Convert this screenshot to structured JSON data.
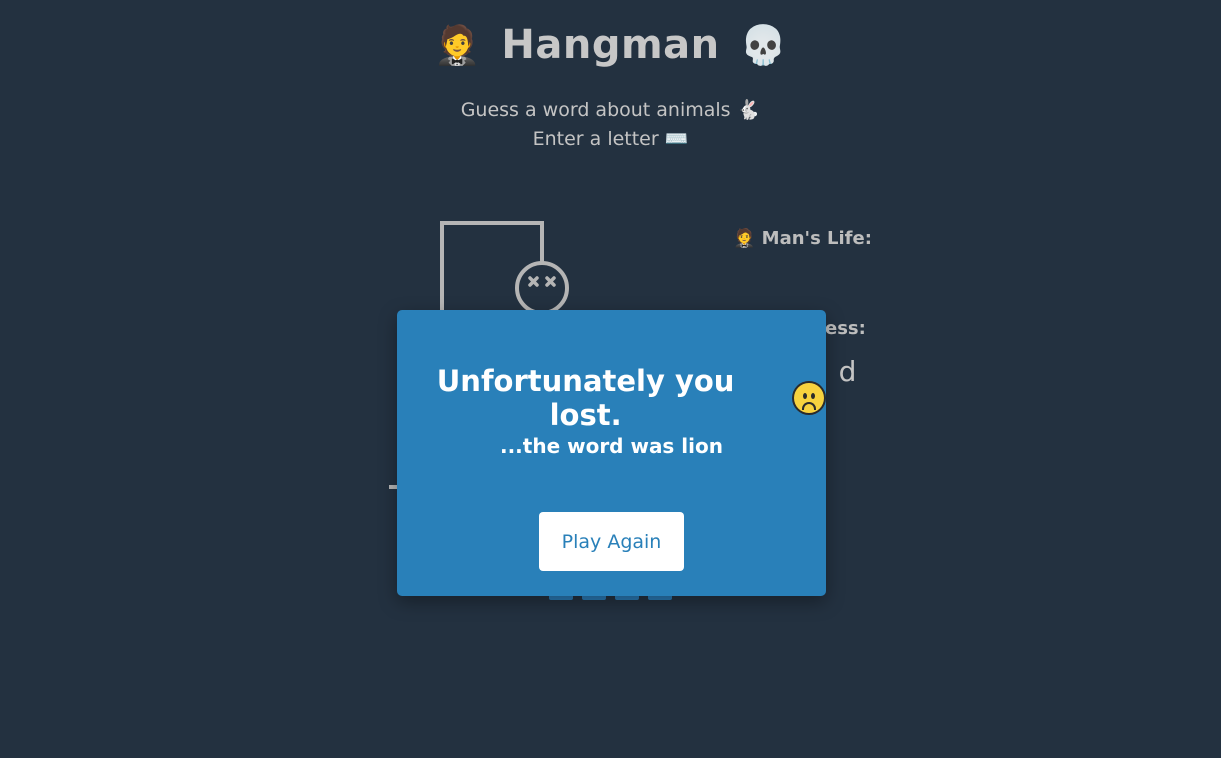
{
  "header": {
    "title": "Hangman",
    "title_left_emoji": "🤵",
    "title_right_emoji": "💀"
  },
  "instructions": {
    "line1": "Guess a word about animals 🐇",
    "line2": "Enter a letter ⌨️"
  },
  "side_panel": {
    "life_label": "🤵 Man's Life:",
    "wrong_label_partial": "ess:",
    "guessed_letters_partial": "h d"
  },
  "word_blanks_count": 4,
  "modal": {
    "title": "Unfortunately you lost.",
    "subtitle": "...the word was lion",
    "play_again_label": "Play Again"
  },
  "colors": {
    "background": "#233140",
    "modal": "#2980b9",
    "button_bg": "#ffffff",
    "button_text": "#2980b9"
  }
}
